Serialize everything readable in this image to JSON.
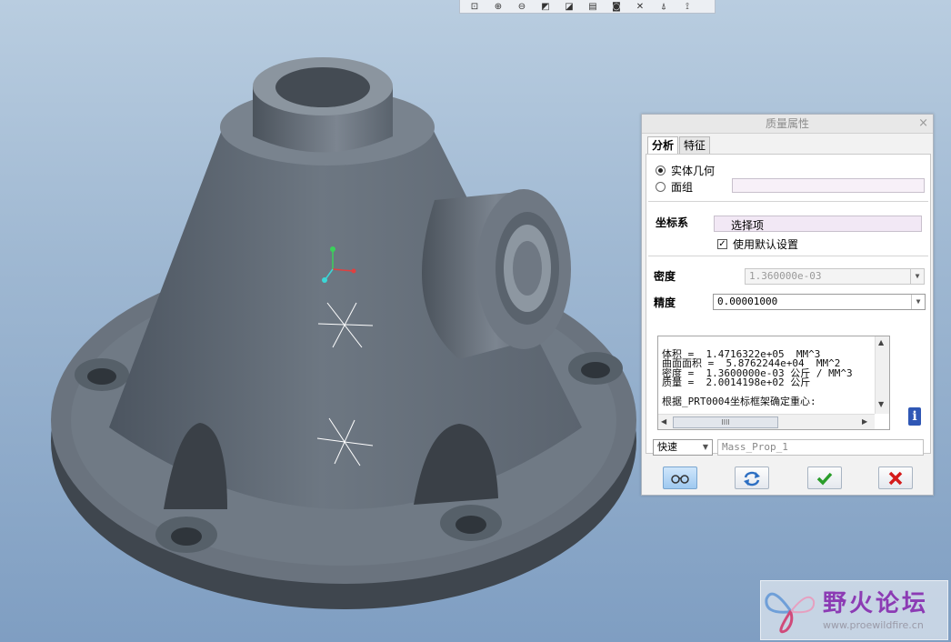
{
  "toolbar": {
    "icons": [
      "zoom-window-icon",
      "zoom-in-icon",
      "zoom-out-icon",
      "refit-icon",
      "orient-icon",
      "saved-views-icon",
      "display-style-icon",
      "datum-planes-icon",
      "datum-axes-icon",
      "datum-points-icon"
    ]
  },
  "dialog": {
    "title": "质量属性",
    "close": "×",
    "tabs": [
      "分析",
      "特征"
    ],
    "geometry": {
      "solid_label": "实体几何",
      "quilt_label": "面组",
      "solid_selected": true
    },
    "csys": {
      "label": "坐标系",
      "select_text": "选择项",
      "use_default_label": "使用默认设置",
      "use_default_checked": true
    },
    "density": {
      "label": "密度",
      "value": "1.360000e-03"
    },
    "accuracy": {
      "label": "精度",
      "value": "0.00001000"
    },
    "results": {
      "lines": [
        "体积 =  1.4716322e+05  MM^3",
        "曲面面积 =  5.8762244e+04  MM^2",
        "密度 =  1.3600000e-03 公斤 / MM^3",
        "质量 =  2.0014198e+02 公斤",
        "",
        "根据_PRT0004坐标框架确定重心:"
      ],
      "hscroll_grip": "IIII"
    },
    "mode": {
      "value": "快速",
      "name_value": "Mass_Prop_1"
    },
    "buttons": {
      "preview": "preview-glasses-icon",
      "repeat": "repeat-arrows-icon",
      "ok": "ok-check-icon",
      "cancel": "cancel-x-icon"
    },
    "colors": {
      "ok_green": "#2a9d2a",
      "cancel_red": "#d41a1a",
      "repeat_blue": "#2d6fc2"
    }
  },
  "watermark": {
    "title": "野火论坛",
    "url": "www.proewildfire.cn"
  }
}
